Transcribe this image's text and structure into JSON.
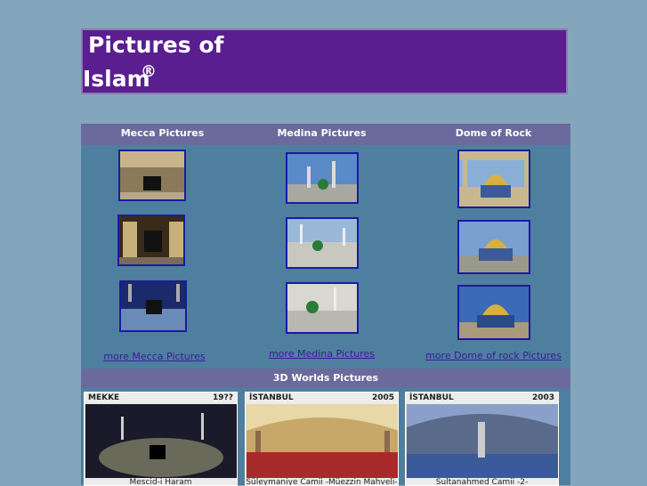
{
  "header": {
    "title_line1": "Pictures of",
    "title_line2": "Islam",
    "reg_mark": "®"
  },
  "columns": [
    {
      "heading": "Mecca Pictures",
      "more": "more Mecca Pictures"
    },
    {
      "heading": "Medina Pictures",
      "more": "more Medina Pictures"
    },
    {
      "heading": "Dome of Rock",
      "more": "more Dome of rock Pictures"
    }
  ],
  "worlds": {
    "heading": "3D Worlds Pictures",
    "cards": [
      {
        "place": "MEKKE",
        "year": "19??",
        "caption": "Mescid-i Haram"
      },
      {
        "place": "İSTANBUL",
        "year": "2005",
        "caption": "Süleymaniye Camii -Müezzin Mahveli-"
      },
      {
        "place": "İSTANBUL",
        "year": "2003",
        "caption": "Sultanahmed Camii -2-"
      }
    ]
  },
  "colors": {
    "background": "#84a6bd",
    "header": "#5a1e90",
    "bar": "#6a6a9c",
    "panel": "#4f7f9e",
    "link": "#3a1c9a"
  }
}
